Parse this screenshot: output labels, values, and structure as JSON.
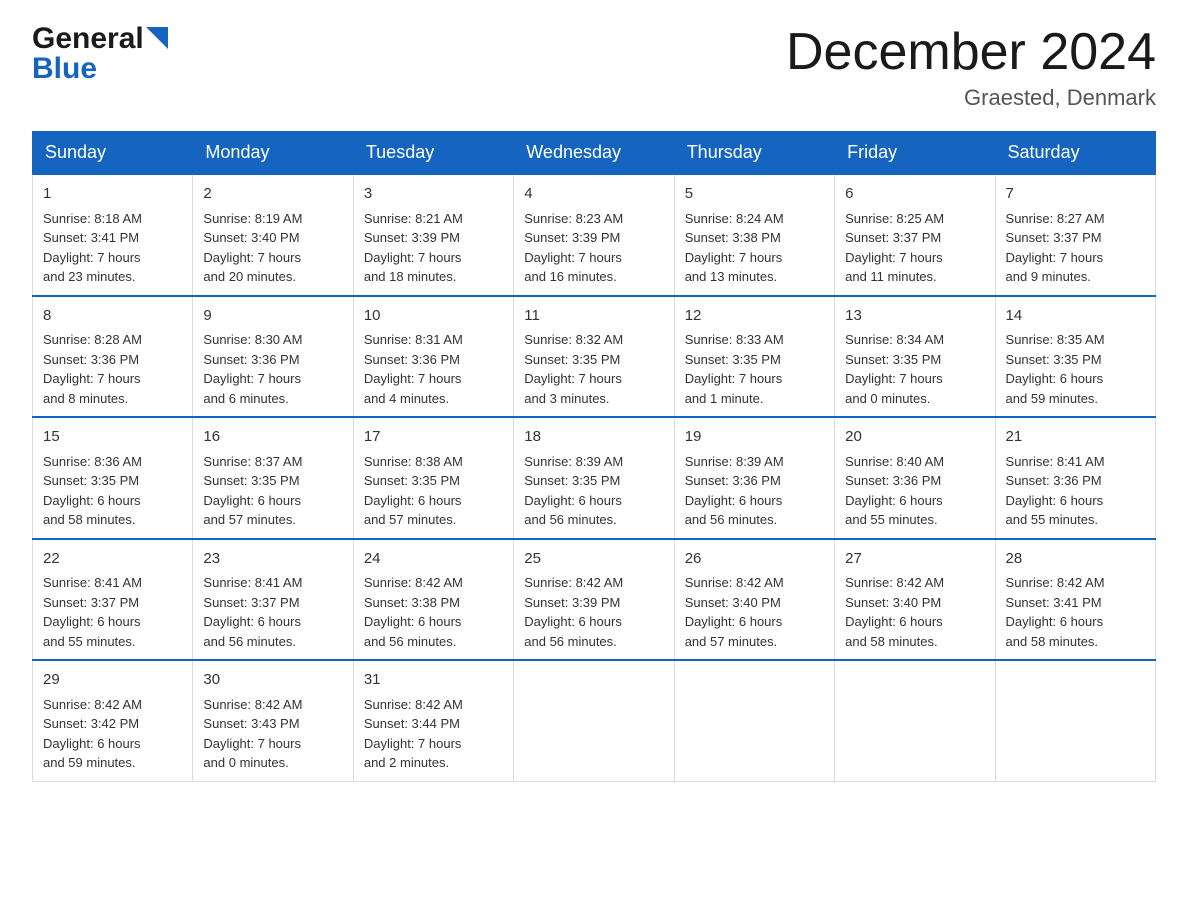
{
  "header": {
    "logo_general": "General",
    "logo_blue": "Blue",
    "month_title": "December 2024",
    "location": "Graested, Denmark"
  },
  "weekdays": [
    "Sunday",
    "Monday",
    "Tuesday",
    "Wednesday",
    "Thursday",
    "Friday",
    "Saturday"
  ],
  "weeks": [
    [
      {
        "day": "1",
        "sunrise": "Sunrise: 8:18 AM",
        "sunset": "Sunset: 3:41 PM",
        "daylight": "Daylight: 7 hours",
        "minutes": "and 23 minutes."
      },
      {
        "day": "2",
        "sunrise": "Sunrise: 8:19 AM",
        "sunset": "Sunset: 3:40 PM",
        "daylight": "Daylight: 7 hours",
        "minutes": "and 20 minutes."
      },
      {
        "day": "3",
        "sunrise": "Sunrise: 8:21 AM",
        "sunset": "Sunset: 3:39 PM",
        "daylight": "Daylight: 7 hours",
        "minutes": "and 18 minutes."
      },
      {
        "day": "4",
        "sunrise": "Sunrise: 8:23 AM",
        "sunset": "Sunset: 3:39 PM",
        "daylight": "Daylight: 7 hours",
        "minutes": "and 16 minutes."
      },
      {
        "day": "5",
        "sunrise": "Sunrise: 8:24 AM",
        "sunset": "Sunset: 3:38 PM",
        "daylight": "Daylight: 7 hours",
        "minutes": "and 13 minutes."
      },
      {
        "day": "6",
        "sunrise": "Sunrise: 8:25 AM",
        "sunset": "Sunset: 3:37 PM",
        "daylight": "Daylight: 7 hours",
        "minutes": "and 11 minutes."
      },
      {
        "day": "7",
        "sunrise": "Sunrise: 8:27 AM",
        "sunset": "Sunset: 3:37 PM",
        "daylight": "Daylight: 7 hours",
        "minutes": "and 9 minutes."
      }
    ],
    [
      {
        "day": "8",
        "sunrise": "Sunrise: 8:28 AM",
        "sunset": "Sunset: 3:36 PM",
        "daylight": "Daylight: 7 hours",
        "minutes": "and 8 minutes."
      },
      {
        "day": "9",
        "sunrise": "Sunrise: 8:30 AM",
        "sunset": "Sunset: 3:36 PM",
        "daylight": "Daylight: 7 hours",
        "minutes": "and 6 minutes."
      },
      {
        "day": "10",
        "sunrise": "Sunrise: 8:31 AM",
        "sunset": "Sunset: 3:36 PM",
        "daylight": "Daylight: 7 hours",
        "minutes": "and 4 minutes."
      },
      {
        "day": "11",
        "sunrise": "Sunrise: 8:32 AM",
        "sunset": "Sunset: 3:35 PM",
        "daylight": "Daylight: 7 hours",
        "minutes": "and 3 minutes."
      },
      {
        "day": "12",
        "sunrise": "Sunrise: 8:33 AM",
        "sunset": "Sunset: 3:35 PM",
        "daylight": "Daylight: 7 hours",
        "minutes": "and 1 minute."
      },
      {
        "day": "13",
        "sunrise": "Sunrise: 8:34 AM",
        "sunset": "Sunset: 3:35 PM",
        "daylight": "Daylight: 7 hours",
        "minutes": "and 0 minutes."
      },
      {
        "day": "14",
        "sunrise": "Sunrise: 8:35 AM",
        "sunset": "Sunset: 3:35 PM",
        "daylight": "Daylight: 6 hours",
        "minutes": "and 59 minutes."
      }
    ],
    [
      {
        "day": "15",
        "sunrise": "Sunrise: 8:36 AM",
        "sunset": "Sunset: 3:35 PM",
        "daylight": "Daylight: 6 hours",
        "minutes": "and 58 minutes."
      },
      {
        "day": "16",
        "sunrise": "Sunrise: 8:37 AM",
        "sunset": "Sunset: 3:35 PM",
        "daylight": "Daylight: 6 hours",
        "minutes": "and 57 minutes."
      },
      {
        "day": "17",
        "sunrise": "Sunrise: 8:38 AM",
        "sunset": "Sunset: 3:35 PM",
        "daylight": "Daylight: 6 hours",
        "minutes": "and 57 minutes."
      },
      {
        "day": "18",
        "sunrise": "Sunrise: 8:39 AM",
        "sunset": "Sunset: 3:35 PM",
        "daylight": "Daylight: 6 hours",
        "minutes": "and 56 minutes."
      },
      {
        "day": "19",
        "sunrise": "Sunrise: 8:39 AM",
        "sunset": "Sunset: 3:36 PM",
        "daylight": "Daylight: 6 hours",
        "minutes": "and 56 minutes."
      },
      {
        "day": "20",
        "sunrise": "Sunrise: 8:40 AM",
        "sunset": "Sunset: 3:36 PM",
        "daylight": "Daylight: 6 hours",
        "minutes": "and 55 minutes."
      },
      {
        "day": "21",
        "sunrise": "Sunrise: 8:41 AM",
        "sunset": "Sunset: 3:36 PM",
        "daylight": "Daylight: 6 hours",
        "minutes": "and 55 minutes."
      }
    ],
    [
      {
        "day": "22",
        "sunrise": "Sunrise: 8:41 AM",
        "sunset": "Sunset: 3:37 PM",
        "daylight": "Daylight: 6 hours",
        "minutes": "and 55 minutes."
      },
      {
        "day": "23",
        "sunrise": "Sunrise: 8:41 AM",
        "sunset": "Sunset: 3:37 PM",
        "daylight": "Daylight: 6 hours",
        "minutes": "and 56 minutes."
      },
      {
        "day": "24",
        "sunrise": "Sunrise: 8:42 AM",
        "sunset": "Sunset: 3:38 PM",
        "daylight": "Daylight: 6 hours",
        "minutes": "and 56 minutes."
      },
      {
        "day": "25",
        "sunrise": "Sunrise: 8:42 AM",
        "sunset": "Sunset: 3:39 PM",
        "daylight": "Daylight: 6 hours",
        "minutes": "and 56 minutes."
      },
      {
        "day": "26",
        "sunrise": "Sunrise: 8:42 AM",
        "sunset": "Sunset: 3:40 PM",
        "daylight": "Daylight: 6 hours",
        "minutes": "and 57 minutes."
      },
      {
        "day": "27",
        "sunrise": "Sunrise: 8:42 AM",
        "sunset": "Sunset: 3:40 PM",
        "daylight": "Daylight: 6 hours",
        "minutes": "and 58 minutes."
      },
      {
        "day": "28",
        "sunrise": "Sunrise: 8:42 AM",
        "sunset": "Sunset: 3:41 PM",
        "daylight": "Daylight: 6 hours",
        "minutes": "and 58 minutes."
      }
    ],
    [
      {
        "day": "29",
        "sunrise": "Sunrise: 8:42 AM",
        "sunset": "Sunset: 3:42 PM",
        "daylight": "Daylight: 6 hours",
        "minutes": "and 59 minutes."
      },
      {
        "day": "30",
        "sunrise": "Sunrise: 8:42 AM",
        "sunset": "Sunset: 3:43 PM",
        "daylight": "Daylight: 7 hours",
        "minutes": "and 0 minutes."
      },
      {
        "day": "31",
        "sunrise": "Sunrise: 8:42 AM",
        "sunset": "Sunset: 3:44 PM",
        "daylight": "Daylight: 7 hours",
        "minutes": "and 2 minutes."
      },
      null,
      null,
      null,
      null
    ]
  ]
}
